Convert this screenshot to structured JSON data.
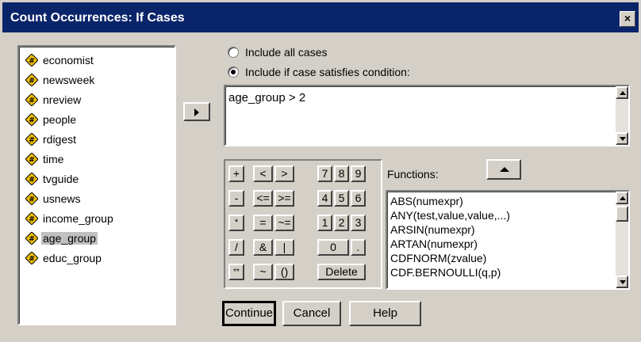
{
  "window": {
    "title": "Count Occurrences: If Cases",
    "close_glyph": "×"
  },
  "variables": [
    {
      "name": "economist",
      "icon": "numeric-variable-icon"
    },
    {
      "name": "newsweek",
      "icon": "numeric-variable-icon"
    },
    {
      "name": "nreview",
      "icon": "numeric-variable-icon"
    },
    {
      "name": "people",
      "icon": "numeric-variable-icon"
    },
    {
      "name": "rdigest",
      "icon": "numeric-variable-icon"
    },
    {
      "name": "time",
      "icon": "numeric-variable-icon"
    },
    {
      "name": "tvguide",
      "icon": "numeric-variable-icon"
    },
    {
      "name": "usnews",
      "icon": "numeric-variable-icon"
    },
    {
      "name": "income_group",
      "icon": "numeric-variable-icon"
    },
    {
      "name": "age_group",
      "icon": "numeric-variable-icon",
      "selected": true
    },
    {
      "name": "educ_group",
      "icon": "numeric-variable-icon"
    }
  ],
  "options": {
    "include_all": "Include all cases",
    "include_if": "Include if case satisfies condition:",
    "selected": "include_if"
  },
  "condition": {
    "value": "age_group > 2"
  },
  "keypad": {
    "rows": [
      [
        "+",
        "<",
        ">",
        "7",
        "8",
        "9"
      ],
      [
        "-",
        "<=",
        ">=",
        "4",
        "5",
        "6"
      ],
      [
        "*",
        "=",
        "~=",
        "1",
        "2",
        "3"
      ],
      [
        "/",
        "&",
        "|",
        "0",
        "."
      ],
      [
        "**",
        "~",
        "()",
        "Delete"
      ]
    ]
  },
  "functions": {
    "label": "Functions:",
    "items": [
      "ABS(numexpr)",
      "ANY(test,value,value,...)",
      "ARSIN(numexpr)",
      "ARTAN(numexpr)",
      "CDFNORM(zvalue)",
      "CDF.BERNOULLI(q,p)"
    ]
  },
  "buttons": {
    "continue": "Continue",
    "cancel": "Cancel",
    "help": "Help"
  },
  "colors": {
    "titlebar": "#0a246a",
    "face": "#d4d0c8",
    "selection": "#c0c0c0",
    "icon_fill": "#f0c000"
  }
}
